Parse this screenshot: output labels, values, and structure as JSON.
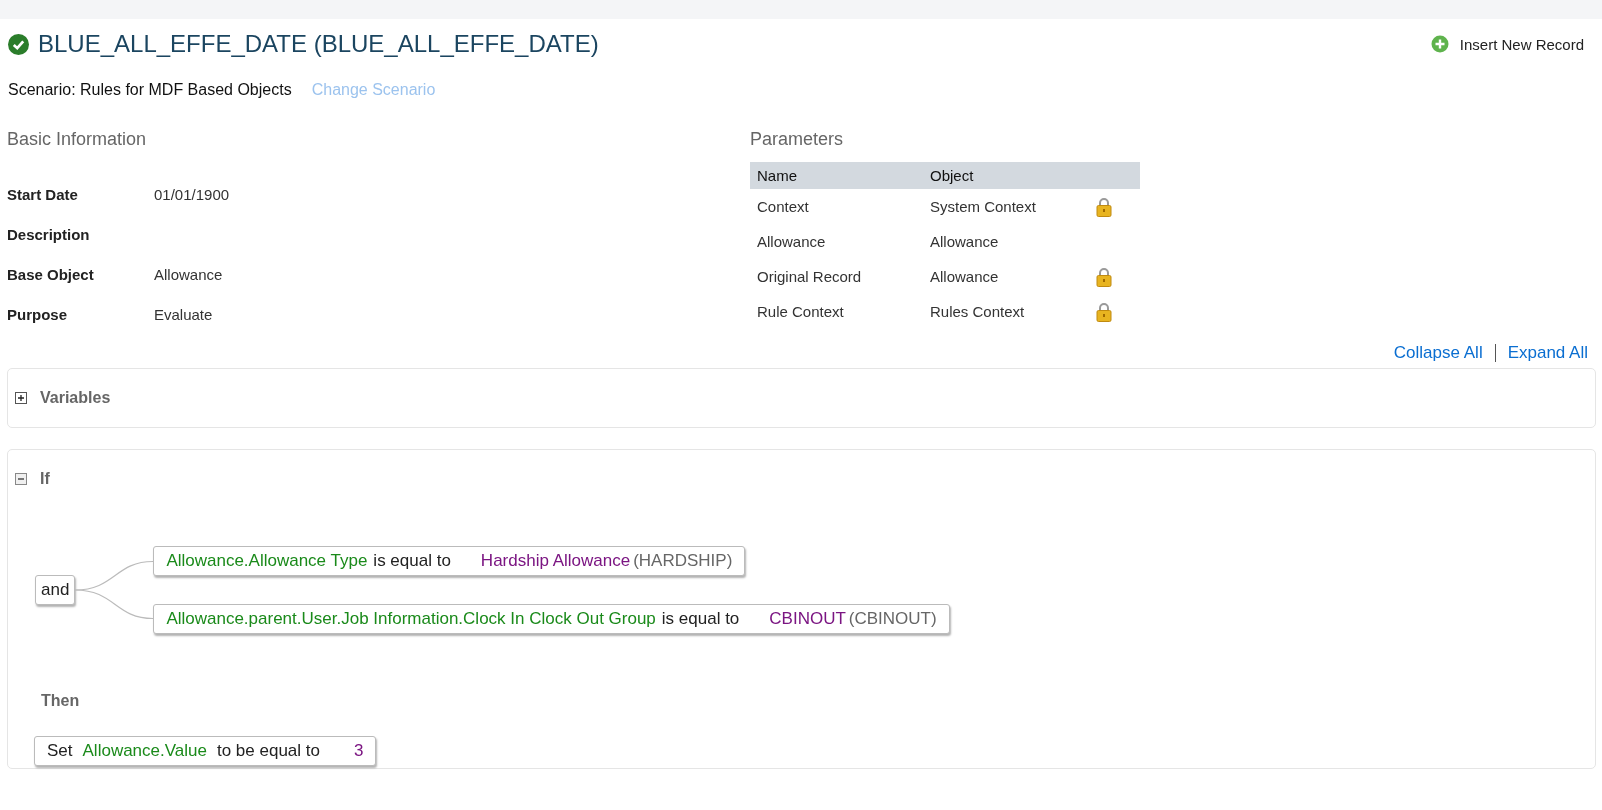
{
  "header": {
    "title": "BLUE_ALL_EFFE_DATE (BLUE_ALL_EFFE_DATE)",
    "valid": true,
    "action": "Insert New Record"
  },
  "scenario": {
    "label": "Scenario: Rules for MDF Based Objects",
    "link": "Change Scenario"
  },
  "basic_information": {
    "heading": "Basic Information",
    "fields": [
      {
        "label": "Start Date",
        "value": "01/01/1900"
      },
      {
        "label": "Description"
      },
      {
        "label": "Base Object",
        "value": "Allowance"
      },
      {
        "label": "Purpose",
        "value": "Evaluate"
      }
    ]
  },
  "parameters": {
    "heading": "Parameters",
    "columns": [
      "Name",
      "Object"
    ],
    "rows": [
      {
        "name": "Context",
        "object": "System Context",
        "locked": true
      },
      {
        "name": "Allowance",
        "object": "Allowance",
        "locked": false
      },
      {
        "name": "Original Record",
        "object": "Allowance",
        "locked": true
      },
      {
        "name": "Rule Context",
        "object": "Rules Context",
        "locked": true
      }
    ]
  },
  "tree_controls": [
    "Collapse All",
    "Expand All"
  ],
  "variables": {
    "title": "Variables",
    "expanded": false
  },
  "if": {
    "title": "If",
    "expanded": true,
    "operator": "and",
    "conditions": [
      {
        "field": "Allowance.Allowance Type",
        "comparison": "is equal to",
        "value": "Hardship Allowance",
        "code": "(HARDSHIP)"
      },
      {
        "field": "Allowance.parent.User.Job Information.Clock In Clock Out Group",
        "comparison": "is equal to",
        "value": "CBINOUT",
        "code": "(CBINOUT)"
      }
    ]
  },
  "then": {
    "title": "Then",
    "actions": [
      {
        "verb": "Set",
        "field": "Allowance.Value",
        "comparison": "to be equal to",
        "value": "3"
      }
    ]
  }
}
